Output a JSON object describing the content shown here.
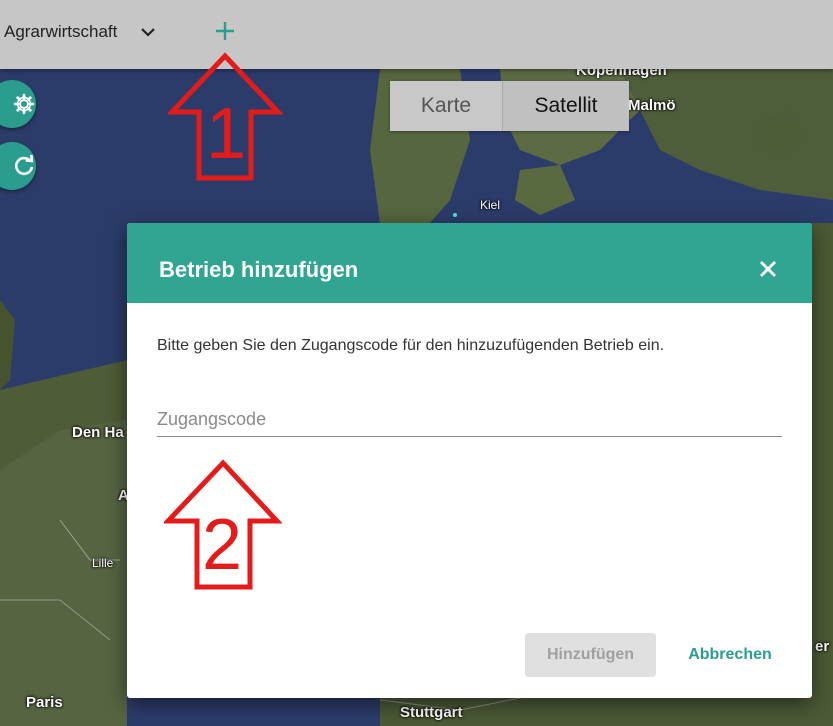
{
  "topbar": {
    "farm_name": "Agrarwirtschaft",
    "add_icon": "plus-icon",
    "dropdown_icon": "chevron-down-icon"
  },
  "fabs": {
    "settings_icon": "gear-icon",
    "refresh_icon": "refresh-icon"
  },
  "map_type": {
    "options": [
      "Karte",
      "Satellit"
    ],
    "selected": "Satellit"
  },
  "map_labels": {
    "kopenhagen": "Kopenhagen",
    "malmo": "Malmö",
    "kiel": "Kiel",
    "den_haag": "Den Ha",
    "a": "A",
    "lille": "Lille",
    "paris": "Paris",
    "stuttgart": "Stuttgart",
    "right_edge": "er"
  },
  "dialog": {
    "title": "Betrieb hinzufügen",
    "description": "Bitte geben Sie den Zugangscode für den hinzuzufügenden Betrieb ein.",
    "code_placeholder": "Zugangscode",
    "code_value": "",
    "add_label": "Hinzufügen",
    "cancel_label": "Abbrechen",
    "close_icon": "close-icon"
  },
  "annotations": {
    "arrow1": "1",
    "arrow2": "2"
  },
  "colors": {
    "accent": "#2fa592",
    "annotation": "#e31b1b",
    "topbar": "#c6c6c6"
  }
}
